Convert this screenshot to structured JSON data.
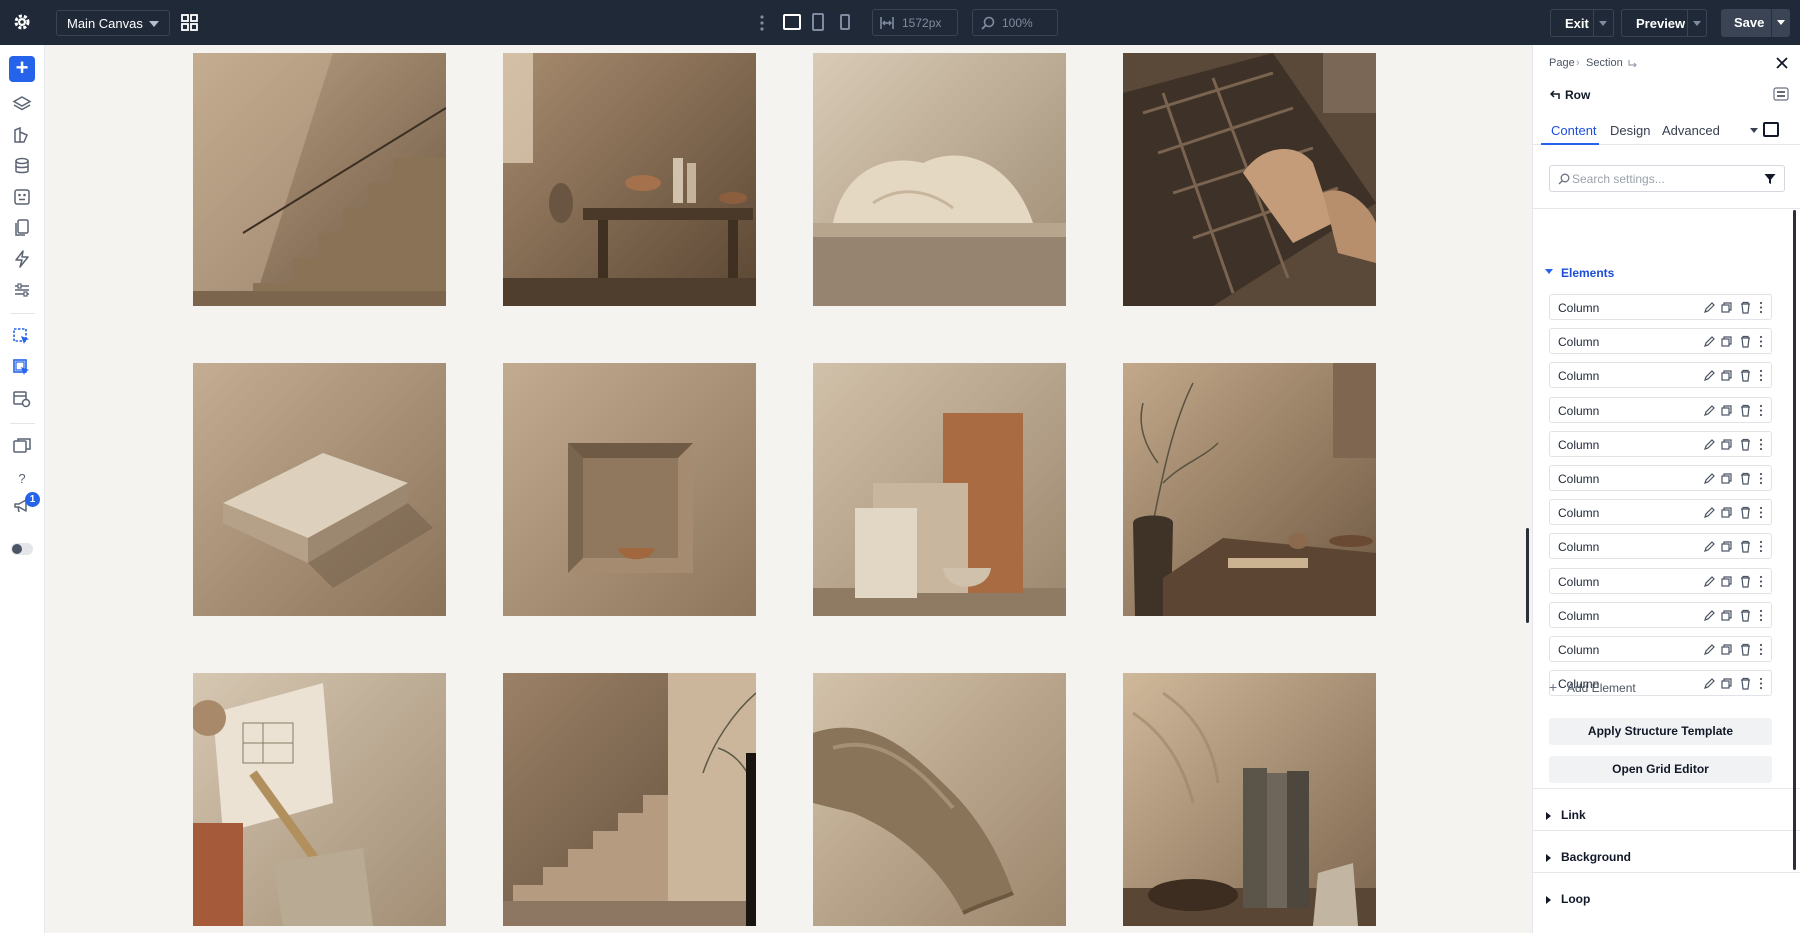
{
  "topbar": {
    "canvas_select": "Main Canvas",
    "width_value": "1572px",
    "zoom_value": "100%",
    "exit_label": "Exit",
    "preview_label": "Preview",
    "save_label": "Save"
  },
  "leftbar": {
    "notification_count": "1"
  },
  "panel": {
    "breadcrumb": [
      "Page",
      "Section"
    ],
    "element_title": "Row",
    "tabs": [
      {
        "label": "Content",
        "active": true
      },
      {
        "label": "Design",
        "active": false
      },
      {
        "label": "Advanced",
        "active": false
      }
    ],
    "search_placeholder": "Search settings...",
    "elements_heading": "Elements",
    "columns": [
      "Column",
      "Column",
      "Column",
      "Column",
      "Column",
      "Column",
      "Column",
      "Column",
      "Column",
      "Column",
      "Column",
      "Column"
    ],
    "add_element_label": "Add Element",
    "apply_template_label": "Apply Structure Template",
    "open_grid_label": "Open Grid Editor",
    "sections": [
      "Link",
      "Background",
      "Loop"
    ]
  },
  "colors": {
    "accent": "#2563eb",
    "topbar_bg": "#1f2937",
    "canvas_bg": "#f4f3f0"
  },
  "gallery": {
    "images": [
      "staircase-photo",
      "ceramics-table-photo",
      "linen-cloth-photo",
      "type-tray-hands-photo",
      "book-block-photo",
      "wall-niche-bowl-photo",
      "material-samples-photo",
      "olive-branch-table-photo",
      "blueprints-ruler-photo",
      "exterior-stairs-photo",
      "folded-linen-photo",
      "books-shadows-photo"
    ]
  }
}
